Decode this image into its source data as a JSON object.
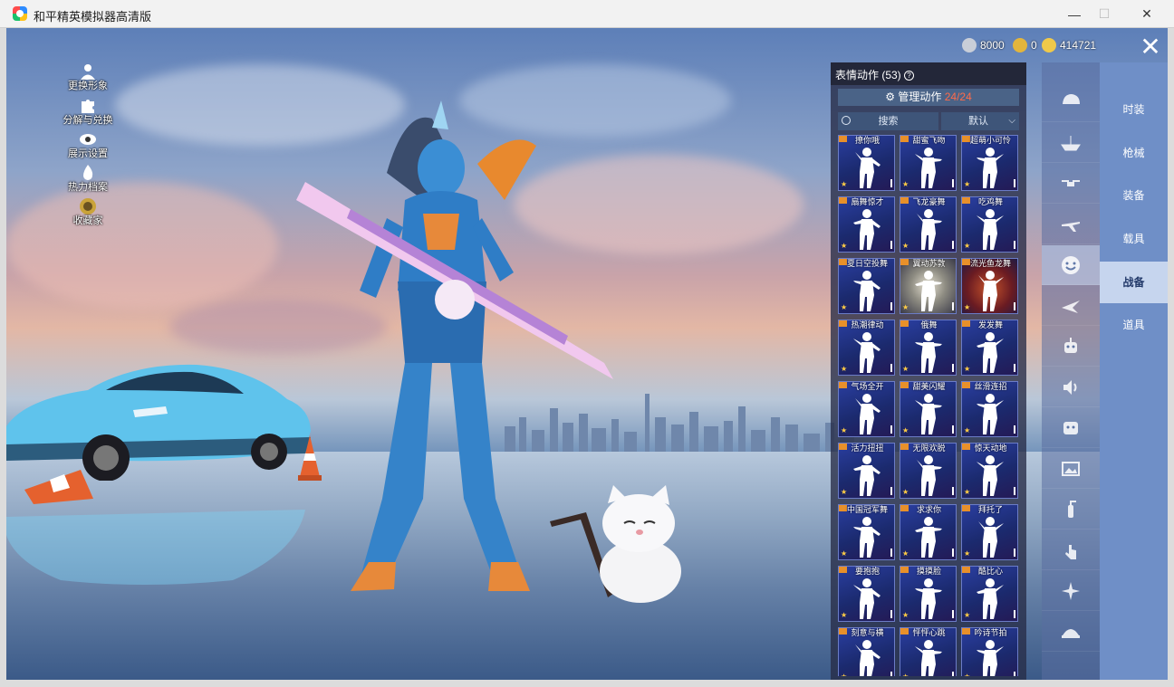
{
  "window": {
    "title": "和平精英模拟器高清版",
    "minimize_glyph": "—",
    "maximize_glyph": "☐",
    "close_glyph": "✕"
  },
  "left_menu": [
    {
      "label": "更换形象",
      "icon": "person-icon"
    },
    {
      "label": "分解与兑换",
      "icon": "puzzle-icon"
    },
    {
      "label": "展示设置",
      "icon": "eye-icon"
    },
    {
      "label": "热力档案",
      "icon": "flame-icon"
    },
    {
      "label": "收藏家",
      "icon": "medal-icon"
    }
  ],
  "currency": [
    {
      "value": "8000",
      "icon": "silver-coin-icon",
      "color": "#c9ced8"
    },
    {
      "value": "0",
      "icon": "gold-token-icon",
      "color": "#e3b53c"
    },
    {
      "value": "414721",
      "icon": "diamond-coin-icon",
      "color": "#f0c94a"
    }
  ],
  "panel": {
    "title": "表情动作 (53)",
    "help_glyph": "?",
    "manage_label": "管理动作",
    "manage_count": "24/24",
    "search_label": "搜索",
    "sort_label": "默认",
    "accent_color": "#ff6b4a",
    "emotes": [
      "撩你哦",
      "甜蜜飞吻",
      "超萌小可怜",
      "扇舞惊才",
      "飞龙豪舞",
      "吃鸡舞",
      "夏日空投舞",
      "翼动苏敦",
      "流光鱼龙舞",
      "热潮律动",
      "俄舞",
      "发发舞",
      "气场全开",
      "甜美闪耀",
      "丝滑连招",
      "活力扭扭",
      "无限欢脱",
      "惊天动地",
      "中国冠军舞",
      "求求你",
      "拜托了",
      "要抱抱",
      "摸摸脸",
      "酷比心",
      "刻意与横",
      "怦怦心跳",
      "吟诗节拍"
    ]
  },
  "rail_icons": [
    "helmet-icon",
    "boat-icon",
    "drone-icon",
    "plane-icon",
    "smiley-icon",
    "glider-icon",
    "robot-icon",
    "speaker-icon",
    "sticker-icon",
    "gallery-icon",
    "extinguisher-icon",
    "tap-icon",
    "sparkle-icon",
    "dome-icon"
  ],
  "tabs": [
    {
      "label": "时装",
      "active": false
    },
    {
      "label": "枪械",
      "active": false
    },
    {
      "label": "装备",
      "active": false
    },
    {
      "label": "载具",
      "active": false
    },
    {
      "label": "战备",
      "active": true
    },
    {
      "label": "道具",
      "active": false
    }
  ]
}
